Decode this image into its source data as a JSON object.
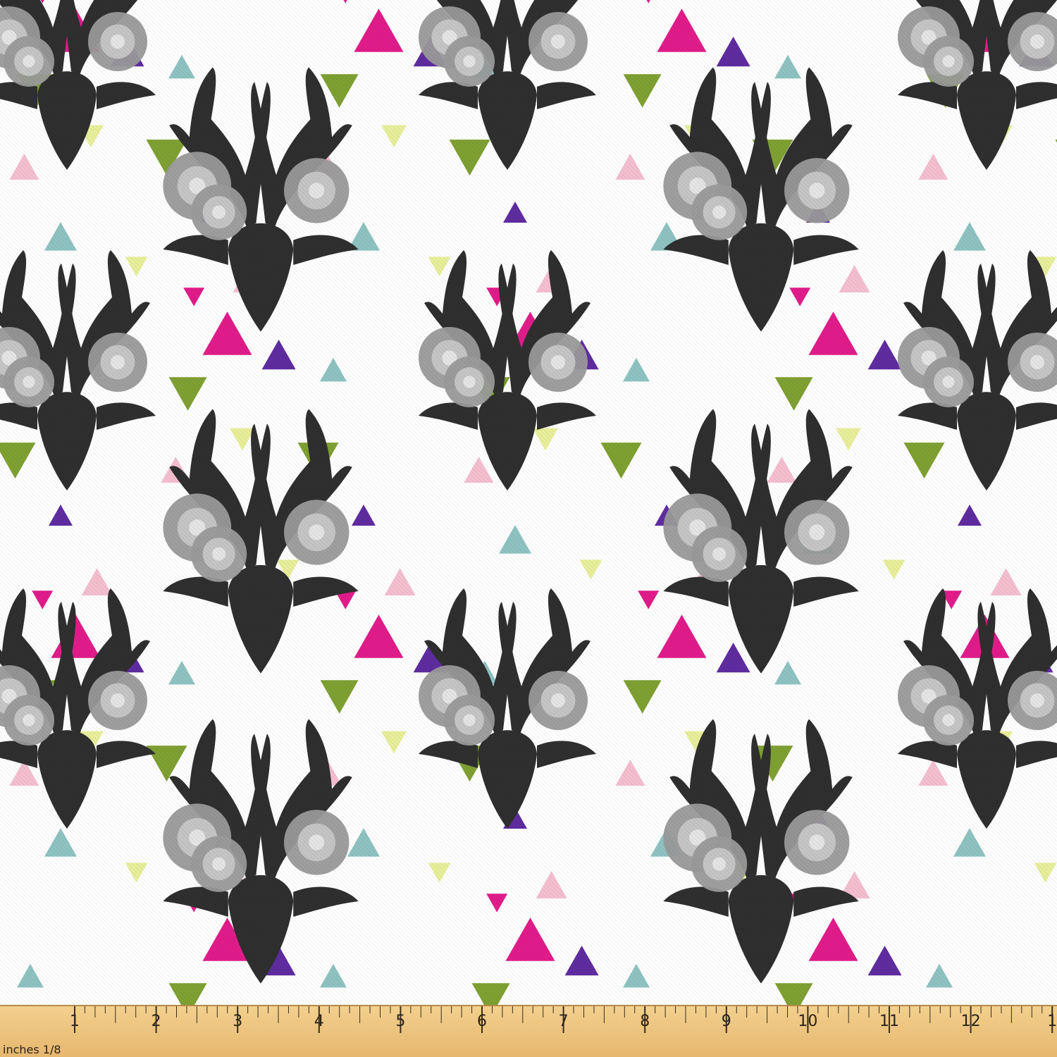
{
  "image": {
    "subject": "fabric-swatch",
    "pattern": {
      "background_color": "#ffffff",
      "silhouette_color": "#2f2f2f",
      "flower_color": "#9a9a9a",
      "triangle_colors": [
        "#e11c8a",
        "#5f2ca0",
        "#7fa032",
        "#8ec3c2",
        "#f4bfd0",
        "#e8ef9b"
      ]
    }
  },
  "ruler": {
    "unit_label": "inches 1/8",
    "numbers": [
      "1",
      "2",
      "3",
      "4",
      "5",
      "6",
      "7",
      "8",
      "9",
      "10",
      "11",
      "12",
      "1"
    ]
  }
}
